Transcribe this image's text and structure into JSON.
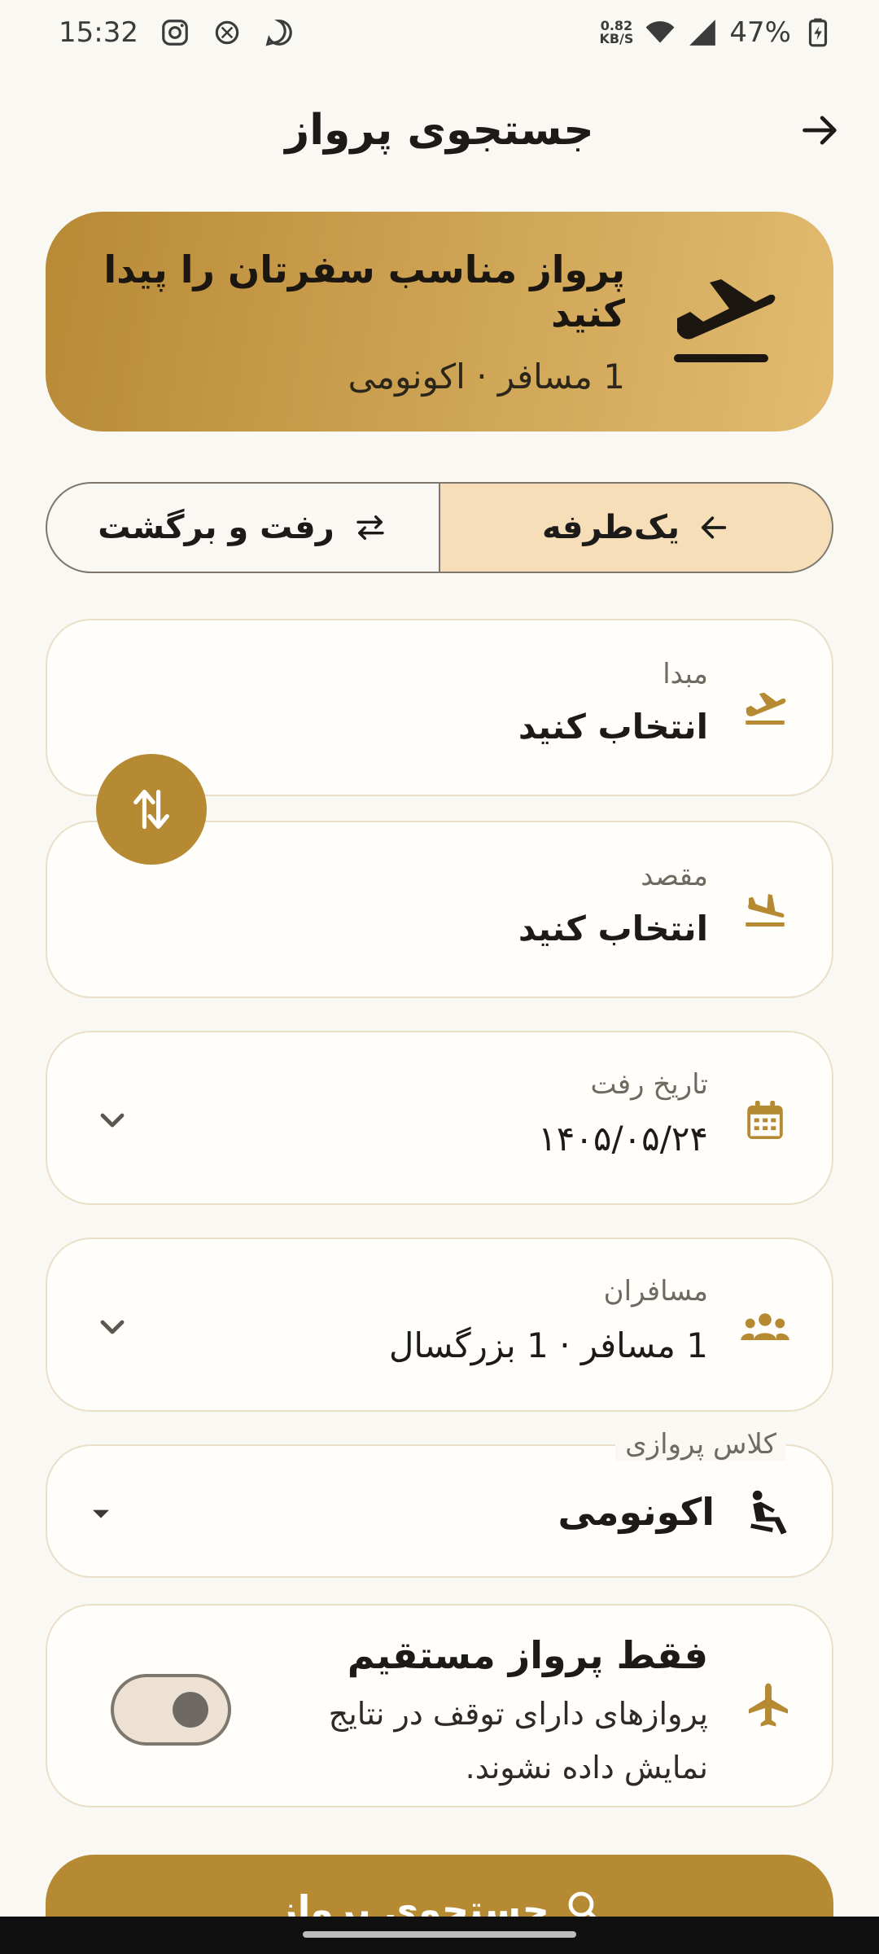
{
  "status_bar": {
    "time": "15:32",
    "net_speed_value": "0.82",
    "net_speed_unit": "KB/S",
    "battery": "47%"
  },
  "header": {
    "title": "جستجوی پرواز"
  },
  "hero": {
    "title": "پرواز مناسب سفرتان را پیدا کنید",
    "subtitle": "1 مسافر · اکونومی"
  },
  "trip_type": {
    "one_way": "یک‌طرفه",
    "round_trip": "رفت و برگشت",
    "selected": "one_way"
  },
  "origin": {
    "label": "مبدا",
    "value": "انتخاب کنید"
  },
  "destination": {
    "label": "مقصد",
    "value": "انتخاب کنید"
  },
  "departure_date": {
    "label": "تاریخ رفت",
    "value": "۱۴۰۵/۰۵/۲۴"
  },
  "passengers": {
    "label": "مسافران",
    "value": "1 مسافر · 1 بزرگسال"
  },
  "flight_class": {
    "label": "کلاس پروازی",
    "value": "اکونومی"
  },
  "direct_only": {
    "title": "فقط پرواز مستقیم",
    "description": "پروازهای دارای توقف در نتایج نمایش داده نشوند.",
    "enabled": false
  },
  "search_button": {
    "label": "جستجوی پرواز"
  },
  "colors": {
    "accent": "#b58a33",
    "background": "#faf8f3",
    "segment_active": "#f6dfb8"
  }
}
